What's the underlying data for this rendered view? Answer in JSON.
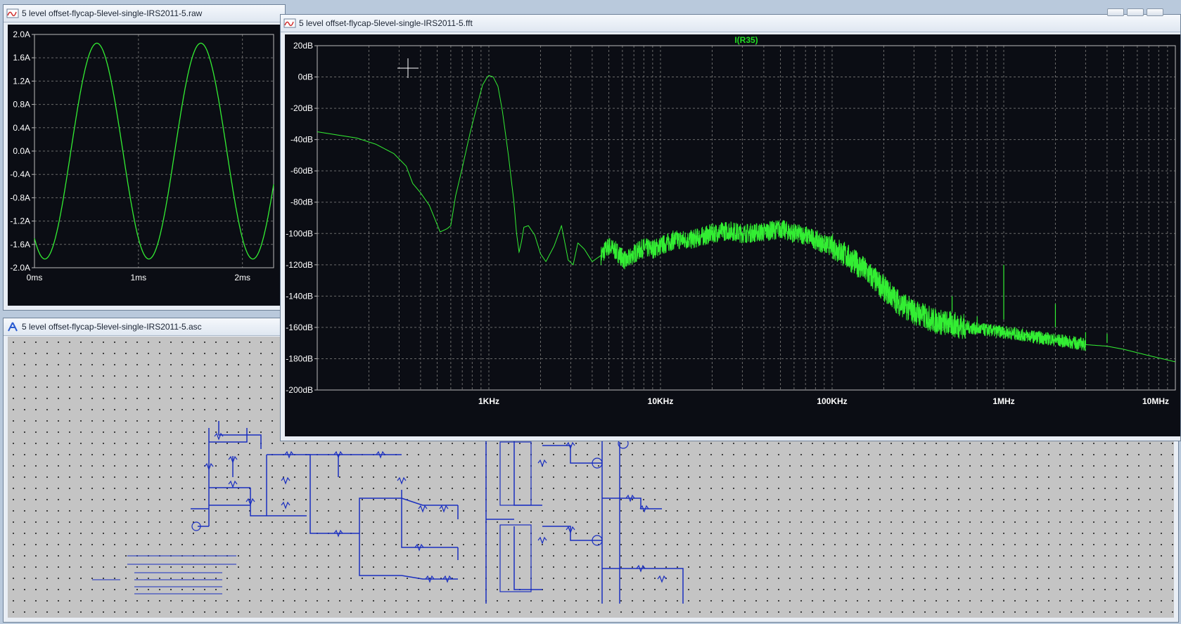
{
  "windows": {
    "raw": {
      "title": "5 level offset-flycap-5level-single-IRS2011-5.raw",
      "icon": "waveform-icon"
    },
    "fft": {
      "title": "5 level offset-flycap-5level-single-IRS2011-5.fft",
      "icon": "waveform-icon"
    },
    "asc": {
      "title": "5 level offset-flycap-5level-single-IRS2011-5.asc",
      "icon": "schematic-icon"
    }
  },
  "colors": {
    "trace": "#33ee33",
    "trace_label": "#22dd22",
    "plot_background": "#0b0d14",
    "axis_text": "#ffffff",
    "grid": "#6a6a6a",
    "wire": "#1a2fc0",
    "schematic_background": "#c4c4c4"
  },
  "chart_data": [
    {
      "type": "line",
      "xlim": [
        0,
        2.3
      ],
      "ylim": [
        -2.0,
        2.0
      ],
      "yticks": [
        "2.0A",
        "1.6A",
        "1.2A",
        "0.8A",
        "0.4A",
        "0.0A",
        "-0.4A",
        "-0.8A",
        "-1.2A",
        "-1.6A",
        "-2.0A"
      ],
      "yvalues": [
        2.0,
        1.6,
        1.2,
        0.8,
        0.4,
        0.0,
        -0.4,
        -0.8,
        -1.2,
        -1.6,
        -2.0
      ],
      "xticks": [
        "0ms",
        "1ms",
        "2ms"
      ],
      "xvalues": [
        0,
        1,
        2
      ],
      "grid": true,
      "series": [
        {
          "amplitude": 1.85,
          "frequency_khz": 1.0,
          "peak_times_ms": [
            0.6,
            1.6
          ],
          "trough_times_ms": [
            0.1,
            1.1,
            2.1
          ]
        }
      ]
    },
    {
      "type": "line",
      "title": "I(R35)",
      "xscale": "log",
      "xlim": [
        100,
        10000000
      ],
      "ylim": [
        -200,
        20
      ],
      "yticks": [
        "20dB",
        "0dB",
        "-20dB",
        "-40dB",
        "-60dB",
        "-80dB",
        "-100dB",
        "-120dB",
        "-140dB",
        "-160dB",
        "-180dB",
        "-200dB"
      ],
      "yvalues": [
        20,
        0,
        -20,
        -40,
        -60,
        -80,
        -100,
        -120,
        -140,
        -160,
        -180,
        -200
      ],
      "xticks": [
        "1KHz",
        "10KHz",
        "100KHz",
        "1MHz",
        "10MHz"
      ],
      "xvalues": [
        1000,
        10000,
        100000,
        1000000,
        10000000
      ],
      "grid": true,
      "series": [
        {
          "name": "I(R35)",
          "x": [
            100,
            130,
            170,
            220,
            280,
            330,
            360,
            400,
            450,
            520,
            570,
            600,
            640,
            700,
            780,
            860,
            920,
            980,
            1000,
            1060,
            1130,
            1200,
            1300,
            1400,
            1450,
            1500,
            1550,
            1600,
            1700,
            1850,
            2000,
            2150,
            2400,
            2650,
            2900,
            3100,
            3300,
            3600,
            4000,
            4500,
            5000,
            5600,
            6300,
            7000,
            8000,
            9000,
            10000,
            12000,
            15000,
            20000,
            25000,
            30000,
            40000,
            50000,
            60000,
            70000,
            80000,
            90000,
            100000,
            120000,
            150000,
            200000,
            250000,
            300000,
            400000,
            500000,
            700000,
            1000000,
            1500000,
            2000000,
            3000000,
            4000000,
            5000000,
            7000000,
            10000000
          ],
          "y": [
            -35,
            -37,
            -39,
            -43,
            -49,
            -57,
            -68,
            -74,
            -82,
            -99,
            -97,
            -95,
            -76,
            -58,
            -35,
            -17,
            -5,
            0,
            1,
            0,
            -6,
            -22,
            -50,
            -80,
            -100,
            -112,
            -105,
            -96,
            -95,
            -101,
            -113,
            -118,
            -108,
            -95,
            -117,
            -120,
            -106,
            -110,
            -118,
            -114,
            -108,
            -112,
            -118,
            -113,
            -109,
            -110,
            -108,
            -104,
            -104,
            -100,
            -98,
            -100,
            -99,
            -97,
            -100,
            -101,
            -104,
            -107,
            -108,
            -114,
            -122,
            -135,
            -145,
            -150,
            -156,
            -158,
            -161,
            -163,
            -166,
            -168,
            -171,
            -172,
            -174,
            -178,
            -182
          ],
          "noise_band_db": 14,
          "spurs": [
            {
              "x": 500000,
              "y": -140
            },
            {
              "x": 700000,
              "y": -160
            },
            {
              "x": 1000000,
              "y": -120
            },
            {
              "x": 2000000,
              "y": -145
            },
            {
              "x": 3000000,
              "y": -167
            },
            {
              "x": 4000000,
              "y": -170
            }
          ]
        }
      ]
    }
  ]
}
